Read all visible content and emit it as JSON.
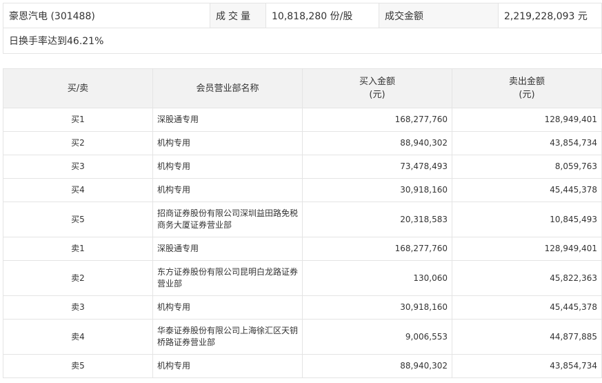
{
  "summary": {
    "stock_name": "豪恩汽电 (301488)",
    "volume_label": "成交量",
    "volume_value": "10,818,280 份/股",
    "amount_label": "成交金额",
    "amount_value": "2,219,228,093 元",
    "turnover_note": "日换手率达到46.21%"
  },
  "table": {
    "headers": {
      "side": "买/卖",
      "member": "会员营业部名称",
      "buy_amount": "买入金额",
      "buy_unit": "(元)",
      "sell_amount": "卖出金额",
      "sell_unit": "(元)"
    },
    "rows": [
      {
        "side": "买1",
        "member": "深股通专用",
        "buy": "168,277,760",
        "sell": "128,949,401"
      },
      {
        "side": "买2",
        "member": "机构专用",
        "buy": "88,940,302",
        "sell": "43,854,734"
      },
      {
        "side": "买3",
        "member": "机构专用",
        "buy": "73,478,493",
        "sell": "8,059,763"
      },
      {
        "side": "买4",
        "member": "机构专用",
        "buy": "30,918,160",
        "sell": "45,445,378"
      },
      {
        "side": "买5",
        "member": "招商证券股份有限公司深圳益田路免税商务大厦证券营业部",
        "buy": "20,318,583",
        "sell": "10,845,493"
      },
      {
        "side": "卖1",
        "member": "深股通专用",
        "buy": "168,277,760",
        "sell": "128,949,401"
      },
      {
        "side": "卖2",
        "member": "东方证券股份有限公司昆明白龙路证券营业部",
        "buy": "130,060",
        "sell": "45,822,363"
      },
      {
        "side": "卖3",
        "member": "机构专用",
        "buy": "30,918,160",
        "sell": "45,445,378"
      },
      {
        "side": "卖4",
        "member": "华泰证券股份有限公司上海徐汇区天钥桥路证券营业部",
        "buy": "9,006,553",
        "sell": "44,877,885"
      },
      {
        "side": "卖5",
        "member": "机构专用",
        "buy": "88,940,302",
        "sell": "43,854,734"
      }
    ]
  }
}
